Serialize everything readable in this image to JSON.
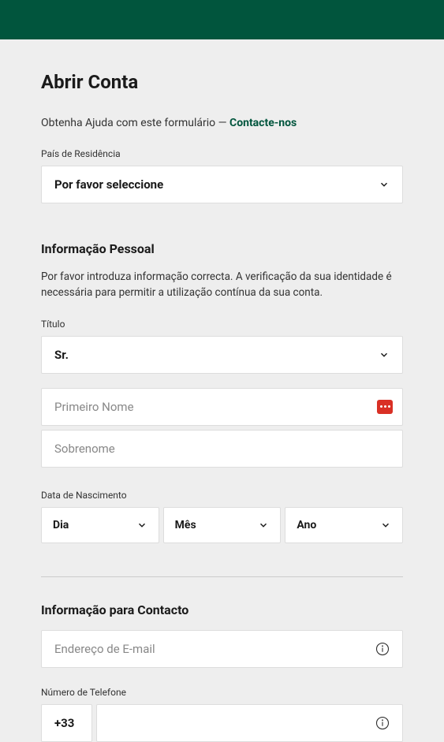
{
  "page": {
    "title": "Abrir Conta",
    "help_prefix": "Obtenha Ajuda com este formulário — ",
    "contact_link": "Contacte-nos"
  },
  "residence": {
    "label": "País de Residência",
    "selected": "Por favor seleccione"
  },
  "personal": {
    "title": "Informação Pessoal",
    "description": "Por favor introduza informação correcta. A verificação da sua identidade é necessária para permitir a utilização contínua da sua conta.",
    "title_label": "Título",
    "title_selected": "Sr.",
    "first_name_placeholder": "Primeiro Nome",
    "last_name_placeholder": "Sobrenome",
    "dob_label": "Data de Nascimento",
    "dob_day": "Dia",
    "dob_month": "Mês",
    "dob_year": "Ano"
  },
  "contact": {
    "title": "Informação para Contacto",
    "email_placeholder": "Endereço de E-mail",
    "phone_label": "Número de Telefone",
    "phone_prefix": "+33"
  }
}
